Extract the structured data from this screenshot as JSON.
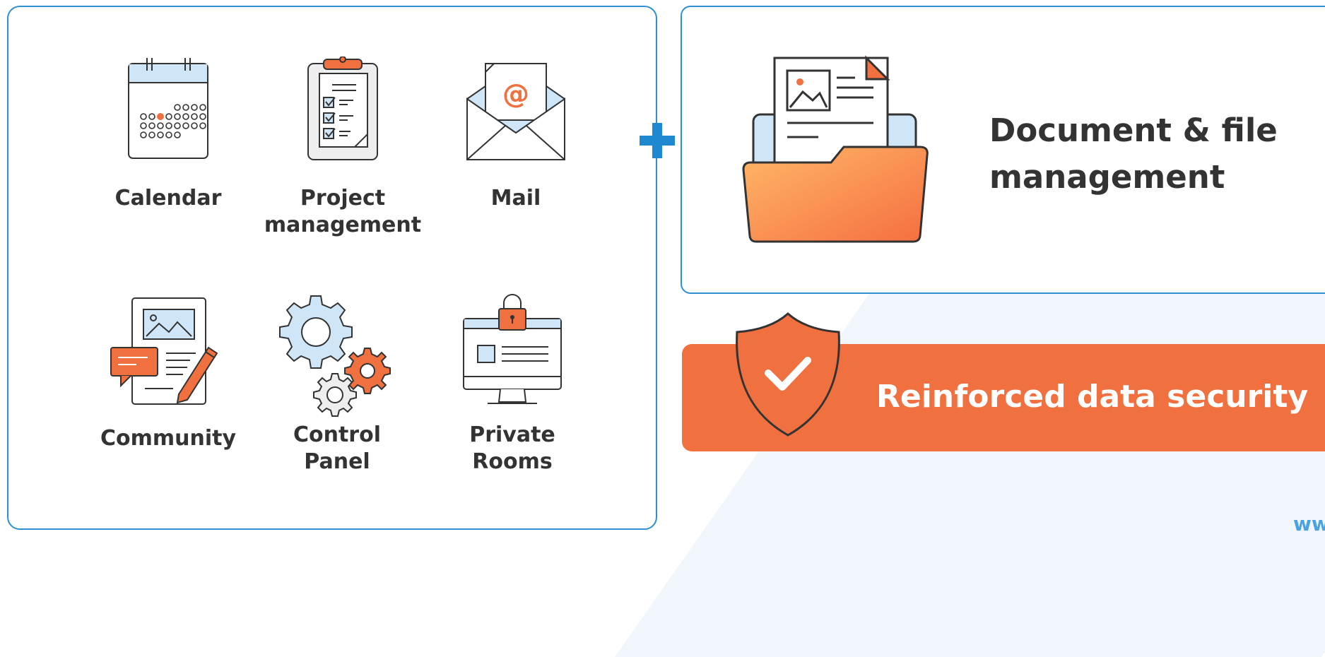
{
  "apps": [
    {
      "label": "Calendar",
      "icon": "calendar-icon"
    },
    {
      "label": "Project\nmanagement",
      "icon": "clipboard-icon"
    },
    {
      "label": "Mail",
      "icon": "mail-icon"
    },
    {
      "label": "Community",
      "icon": "community-icon"
    },
    {
      "label": "Control\nPanel",
      "icon": "gears-icon"
    },
    {
      "label": "Private\nRooms",
      "icon": "monitor-lock-icon"
    }
  ],
  "mail_symbol": "@",
  "document": {
    "title": "Document & file\nmanagement",
    "icon": "folder-icon"
  },
  "security": {
    "label": "Reinforced data security",
    "icon": "shield-check-icon"
  },
  "footer": {
    "url": "www.o"
  },
  "colors": {
    "border": "#2f8fd0",
    "accent": "#f07040",
    "icon_fill": "#cfe6f8",
    "text": "#333333",
    "url": "#4aa3e0"
  }
}
